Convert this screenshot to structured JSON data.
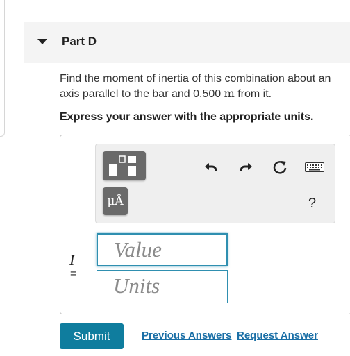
{
  "part": {
    "title": "Part D"
  },
  "question": {
    "text_before": "Find the moment of inertia of this combination about an axis parallel to the bar and 0.500 ",
    "unit": "m",
    "text_after": " from it."
  },
  "instruction": "Express your answer with the appropriate units.",
  "toolbar": {
    "templates_icon": "templates-icon",
    "mu_label": "μÅ",
    "undo_icon": "undo-icon",
    "redo_icon": "redo-icon",
    "reset_icon": "reset-icon",
    "keyboard_icon": "keyboard-icon",
    "help_label": "?"
  },
  "answer": {
    "variable": "I",
    "equals": "=",
    "value_placeholder": "Value",
    "units_placeholder": "Units"
  },
  "actions": {
    "submit_label": "Submit",
    "previous_answers_label": "Previous Answers",
    "request_answer_label": "Request Answer"
  },
  "colors": {
    "submit_bg": "#0f7d9e",
    "link": "#1a6fa6",
    "field_border": "#2f8fb0"
  }
}
